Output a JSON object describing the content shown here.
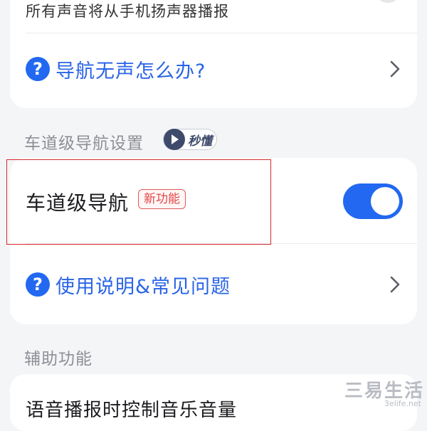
{
  "top_card": {
    "subtext": "所有声音将从手机扬声器播报",
    "help_label": "导航无声怎么办?"
  },
  "lane_section": {
    "title": "车道级导航设置",
    "badge_label": "秒懂",
    "lane_nav_label": "车道级导航",
    "new_badge": "新功能",
    "toggle_on": true,
    "help_label": "使用说明&常见问题"
  },
  "assist_section": {
    "title": "辅助功能",
    "first_item": "语音播报时控制音乐音量"
  },
  "watermark": {
    "text": "三易生活",
    "sub": "3elife.net"
  },
  "colors": {
    "accent": "#2268f0",
    "link": "#2a64e6",
    "new_badge": "#e14848",
    "highlight": "#d6282b"
  }
}
